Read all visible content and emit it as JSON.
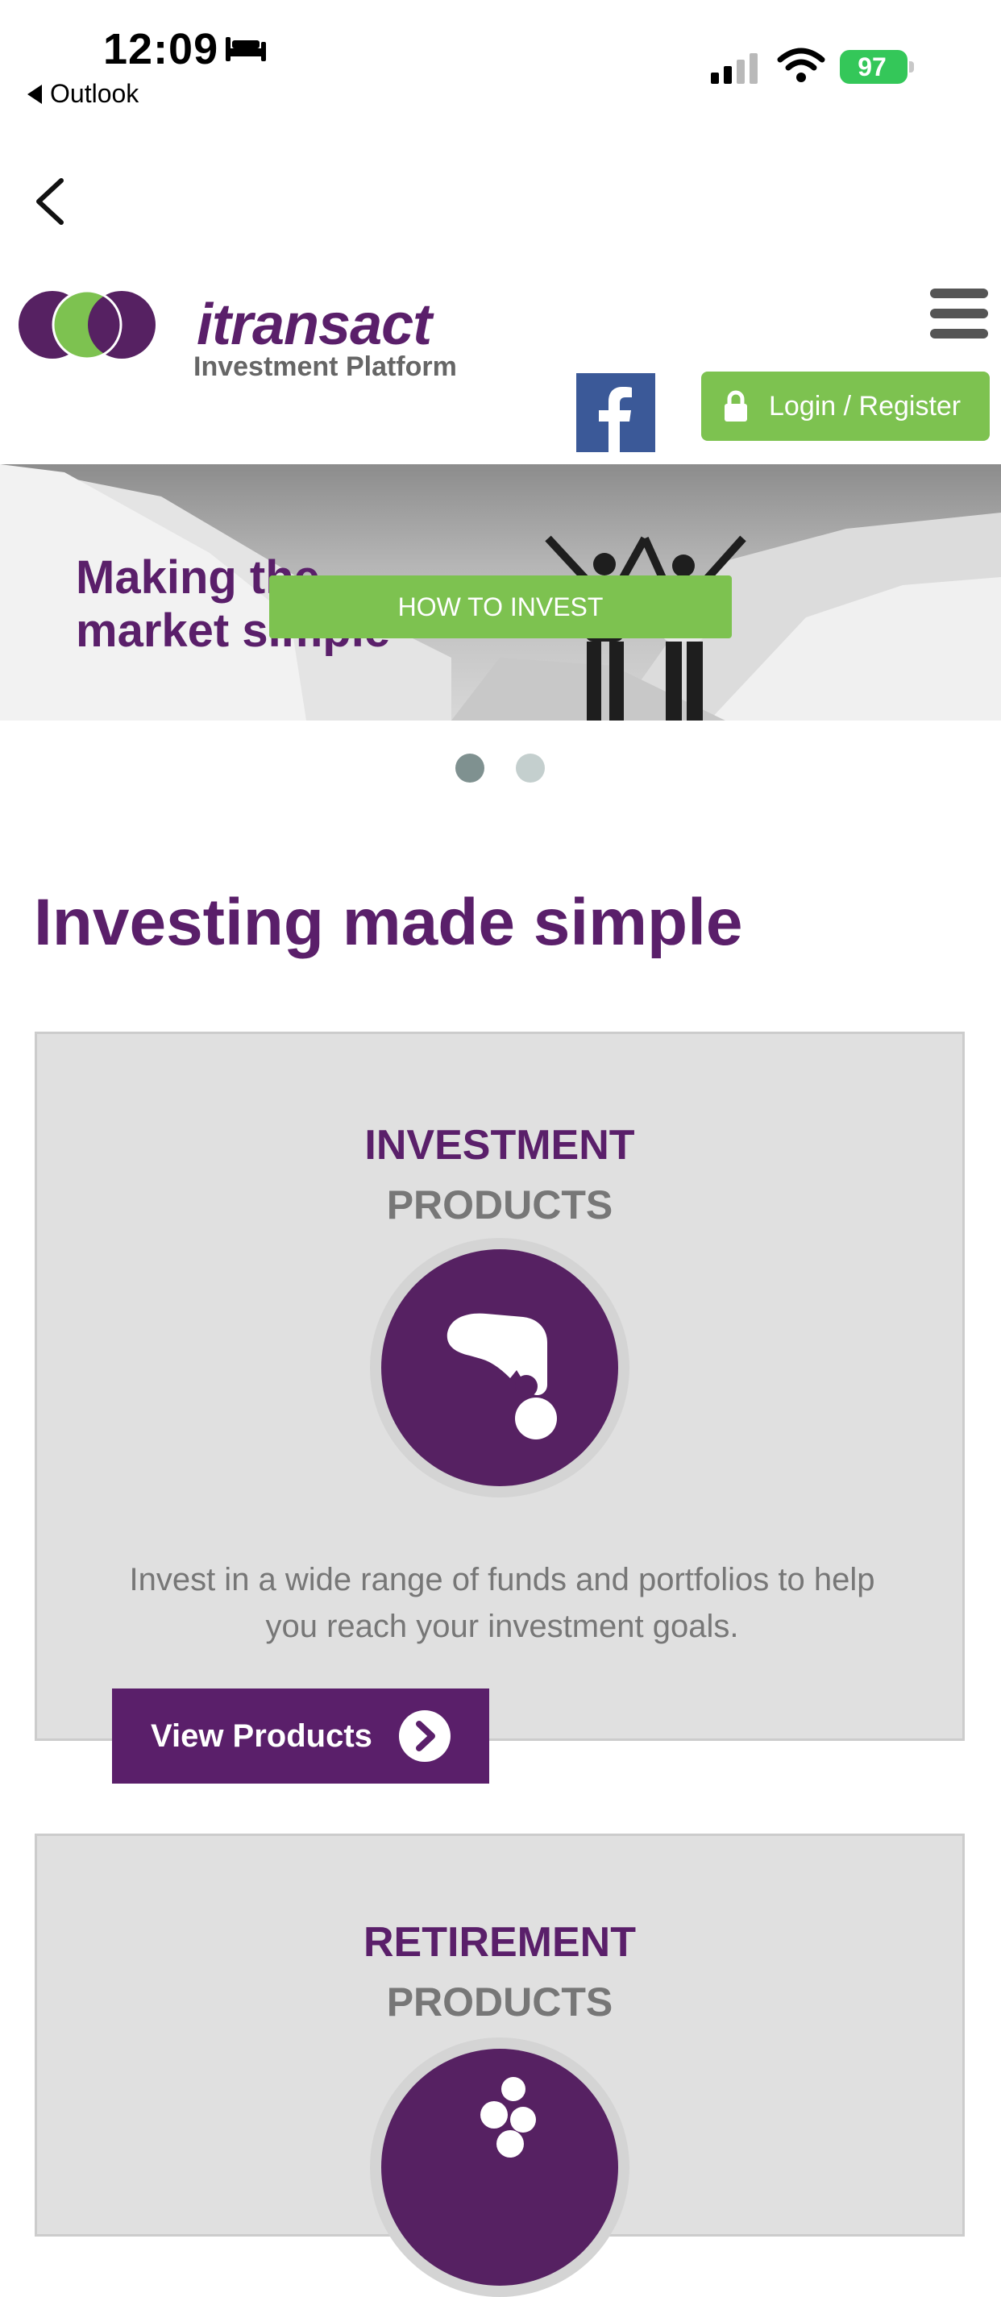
{
  "status_bar": {
    "time": "12:09",
    "back_app": "Outlook",
    "battery": "97"
  },
  "header": {
    "brand_name": "itransact",
    "brand_sub": "Investment Platform",
    "login_label": "Login / Register"
  },
  "banner": {
    "text_line1": "Making the",
    "text_line2": "market simple",
    "cta": "HOW TO INVEST"
  },
  "main": {
    "title": "Investing made simple",
    "cards": [
      {
        "head1": "INVESTMENT",
        "head2": "PRODUCTS",
        "text_line1": "Invest in a wide range of funds and portfolios to help",
        "text_line2": "you reach your investment goals.",
        "button": "View Products"
      },
      {
        "head1": "RETIREMENT",
        "head2": "PRODUCTS"
      }
    ]
  },
  "colors": {
    "brand_purple": "#5a1f6a",
    "accent_green": "#7dc250",
    "facebook_blue": "#3b5998"
  }
}
